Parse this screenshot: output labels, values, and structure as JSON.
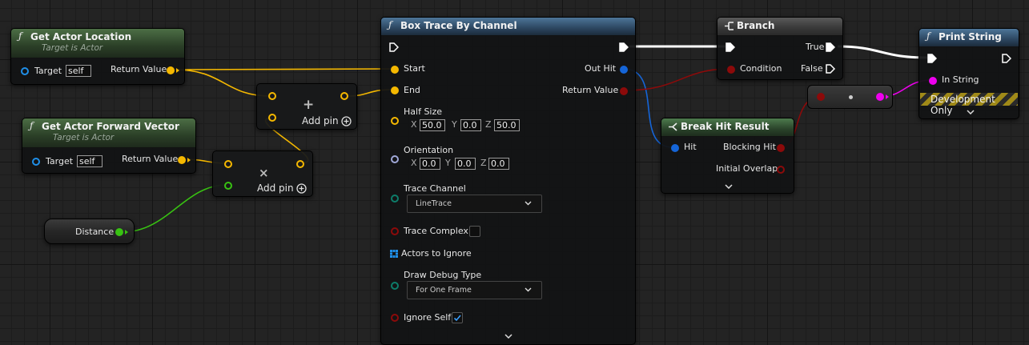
{
  "colors": {
    "exec": "#ffffff",
    "vector": "#f5b800",
    "object": "#1f8fe8",
    "struct": "#1565d8",
    "boolean": "#8c0a0a",
    "float": "#38c212",
    "string": "#ee00ee",
    "byte": "#0d7d6a"
  },
  "nodes": {
    "get_actor_location": {
      "title": "Get Actor Location",
      "subtitle": "Target is Actor",
      "target_label": "Target",
      "target_value": "self",
      "return_label": "Return Value"
    },
    "get_actor_forward_vector": {
      "title": "Get Actor Forward Vector",
      "subtitle": "Target is Actor",
      "target_label": "Target",
      "target_value": "self",
      "return_label": "Return Value"
    },
    "add_node": {
      "op_symbol": "+",
      "add_pin_label": "Add pin"
    },
    "multiply_node": {
      "op_symbol": "×",
      "add_pin_label": "Add pin"
    },
    "distance": {
      "label": "Distance"
    },
    "box_trace": {
      "title": "Box Trace By Channel",
      "start_label": "Start",
      "end_label": "End",
      "half_size_label": "Half Size",
      "half_size": {
        "x_label": "X",
        "x": "50.0",
        "y_label": "Y",
        "y": "0.0",
        "z_label": "Z",
        "z": "50.0"
      },
      "orientation_label": "Orientation",
      "orientation": {
        "x_label": "X",
        "x": "0.0",
        "y_label": "Y",
        "y": "0.0",
        "z_label": "Z",
        "z": "0.0"
      },
      "trace_channel_label": "Trace Channel",
      "trace_channel_value": "LineTrace",
      "trace_complex_label": "Trace Complex",
      "trace_complex_checked": false,
      "actors_to_ignore_label": "Actors to Ignore",
      "draw_debug_type_label": "Draw Debug Type",
      "draw_debug_type_value": "For One Frame",
      "ignore_self_label": "Ignore Self",
      "ignore_self_checked": true,
      "out_hit_label": "Out Hit",
      "return_label": "Return Value"
    },
    "branch": {
      "title": "Branch",
      "condition_label": "Condition",
      "true_label": "True",
      "false_label": "False"
    },
    "break_hit_result": {
      "title": "Break Hit Result",
      "hit_label": "Hit",
      "blocking_hit_label": "Blocking Hit",
      "initial_overlap_label": "Initial Overlap"
    },
    "print_string": {
      "title": "Print String",
      "in_string_label": "In String",
      "development_only_label": "Development Only"
    }
  }
}
